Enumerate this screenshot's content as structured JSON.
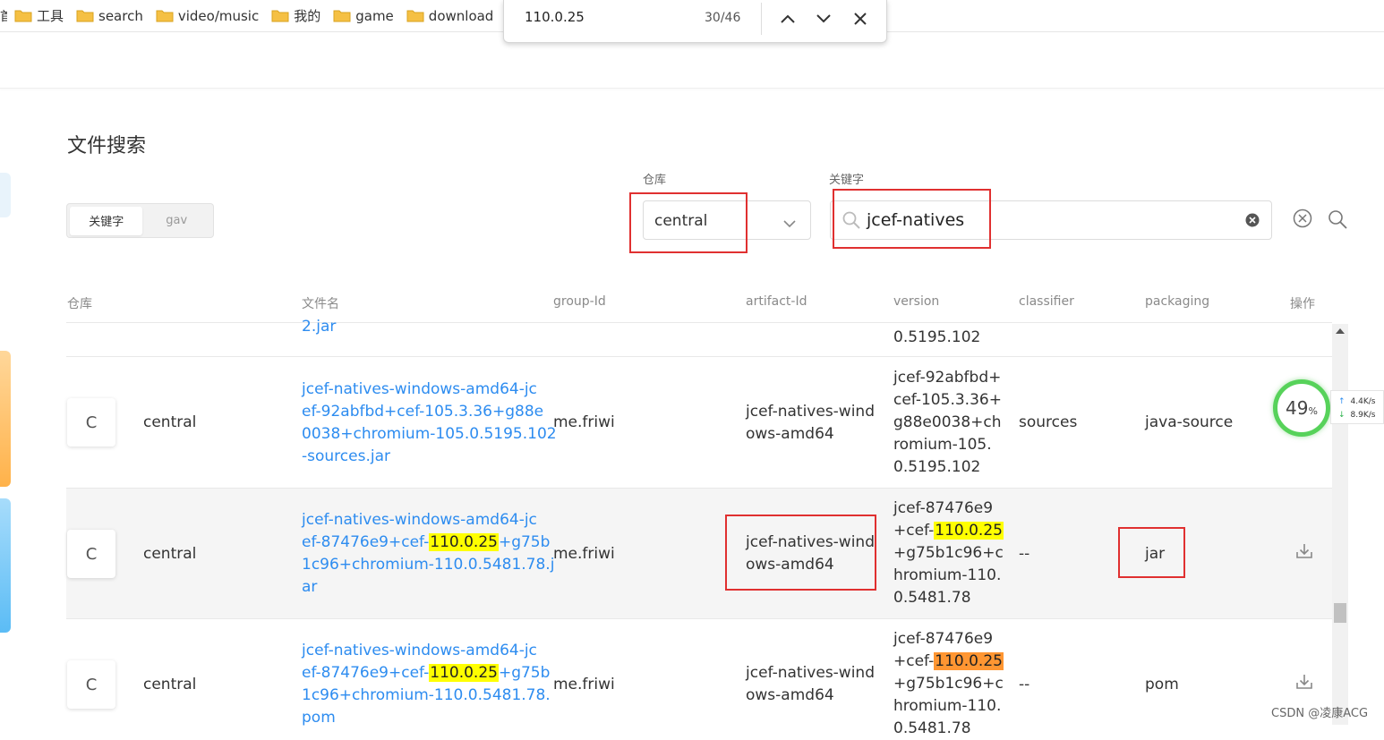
{
  "bookmarks": {
    "cut_label": "首",
    "items": [
      {
        "label": "工具"
      },
      {
        "label": "search"
      },
      {
        "label": "video/music"
      },
      {
        "label": "我的"
      },
      {
        "label": "game"
      },
      {
        "label": "download"
      }
    ]
  },
  "find_bar": {
    "query": "110.0.25",
    "count": "30/46"
  },
  "page": {
    "title": "文件搜索",
    "mode_options": [
      "关键字",
      "gav"
    ],
    "repo_label": "仓库",
    "repo_value": "central",
    "keyword_label": "关键字",
    "keyword_value": "jcef-natives"
  },
  "table": {
    "headers": [
      "仓库",
      "文件名",
      "group-Id",
      "artifact-Id",
      "version",
      "classifier",
      "packaging",
      "操作"
    ],
    "partial_row": {
      "filename_tail": "2.jar",
      "version_tail": "0.5195.102"
    },
    "rows": [
      {
        "badge": "C",
        "repo": "central",
        "filename_lines": [
          "jcef-natives-windows-amd64-jc",
          "ef-92abfbd+cef-105.3.36+g88e",
          "0038+chromium-105.0.5195.102",
          "-sources.jar"
        ],
        "group_id": "me.friwi",
        "artifact_lines": [
          "jcef-natives-wind",
          "ows-amd64"
        ],
        "version_lines": [
          "jcef-92abfbd+",
          "cef-105.3.36+",
          "g88e0038+ch",
          "romium-105.",
          "0.5195.102"
        ],
        "classifier": "sources",
        "packaging": "java-source"
      },
      {
        "badge": "C",
        "repo": "central",
        "filename_pre": [
          "jcef-natives-windows-amd64-jc",
          "ef-87476e9+cef-"
        ],
        "filename_mark": "110.0.25",
        "filename_post": [
          "+g75b",
          "1c96+chromium-110.0.5481.78.j",
          "ar"
        ],
        "group_id": "me.friwi",
        "artifact_lines": [
          "jcef-natives-wind",
          "ows-amd64"
        ],
        "version_pre": [
          "jcef-87476e9",
          "+cef-"
        ],
        "version_mark": "110.0.25",
        "version_post": [
          "+g75b1c96+c",
          "hromium-110.",
          "0.5481.78"
        ],
        "classifier": "--",
        "packaging": "jar"
      },
      {
        "badge": "C",
        "repo": "central",
        "filename_pre": [
          "jcef-natives-windows-amd64-jc",
          "ef-87476e9+cef-"
        ],
        "filename_mark": "110.0.25",
        "filename_post": [
          "+g75b",
          "1c96+chromium-110.0.5481.78.",
          "pom"
        ],
        "group_id": "me.friwi",
        "artifact_lines": [
          "jcef-natives-wind",
          "ows-amd64"
        ],
        "version_pre": [
          "jcef-87476e9",
          "+cef-"
        ],
        "version_mark": "110.0.25",
        "version_post": [
          "+g75b1c96+c",
          "hromium-110.",
          "0.5481.78"
        ],
        "classifier": "--",
        "packaging": "pom"
      }
    ]
  },
  "net_widget": {
    "percent": "49",
    "percent_unit": "%",
    "up_speed": "4.4K/s",
    "down_speed": "8.9K/s"
  },
  "watermark": "CSDN @凌康ACG",
  "colors": {
    "link": "#2d8cf0",
    "highlight": "#ffff00",
    "current_match": "#ff9632",
    "annotation_red": "#e03030",
    "net_ring": "#57d25a"
  }
}
